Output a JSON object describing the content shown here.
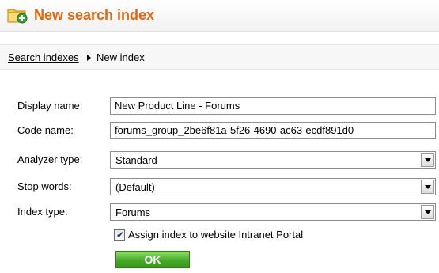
{
  "header": {
    "title": "New search index",
    "icon": "folder-add-icon"
  },
  "breadcrumb": {
    "parent": "Search indexes",
    "current": "New index"
  },
  "form": {
    "display_name": {
      "label": "Display name:",
      "value": "New Product Line - Forums"
    },
    "code_name": {
      "label": "Code name:",
      "value": "forums_group_2be6f81a-5f26-4690-ac63-ecdf891d0"
    },
    "analyzer_type": {
      "label": "Analyzer type:",
      "value": "Standard"
    },
    "stop_words": {
      "label": "Stop words:",
      "value": "(Default)"
    },
    "index_type": {
      "label": "Index type:",
      "value": "Forums"
    },
    "assign_checkbox": {
      "label": "Assign index to website Intranet Portal",
      "checked": true
    },
    "ok_label": "OK"
  },
  "colors": {
    "title": "#e8650a",
    "ok_button": "#4fb52a"
  }
}
